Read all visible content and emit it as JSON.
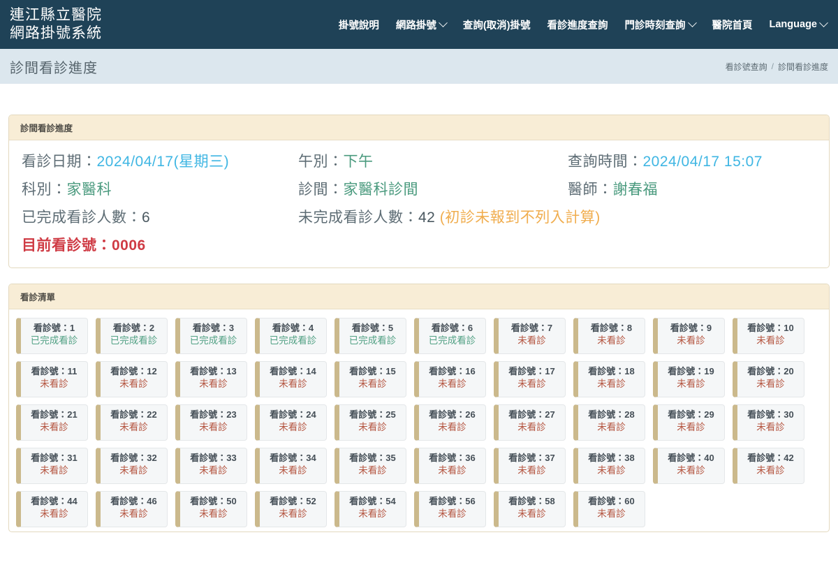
{
  "brand": {
    "line1": "連江縣立醫院",
    "line2": "網路掛號系統"
  },
  "nav": {
    "items": [
      {
        "label": "掛號說明",
        "caret": false
      },
      {
        "label": "網路掛號",
        "caret": true
      },
      {
        "label": "查詢(取消)掛號",
        "caret": false
      },
      {
        "label": "看診進度查詢",
        "caret": false
      },
      {
        "label": "門診時刻查詢",
        "caret": true
      },
      {
        "label": "醫院首頁",
        "caret": false
      },
      {
        "label": "Language",
        "caret": true
      }
    ]
  },
  "header": {
    "page_title": "診間看診進度",
    "breadcrumb_parent": "看診號查詢",
    "breadcrumb_sep": "/",
    "breadcrumb_current": "診間看診進度"
  },
  "progress_panel": {
    "title": "診間看診進度",
    "visit_date_label": "看診日期：",
    "visit_date_value": "2024/04/17(星期三)",
    "session_label": "午別：",
    "session_value": "下午",
    "query_time_label": "查詢時間：",
    "query_time_value": "2024/04/17 15:07",
    "dept_label": "科別：",
    "dept_value": "家醫科",
    "room_label": "診間：",
    "room_value": "家醫科診間",
    "doctor_label": "醫師：",
    "doctor_value": "謝春福",
    "completed_label": "已完成看診人數：",
    "completed_value": "6",
    "incomplete_label": "未完成看診人數：",
    "incomplete_value": "42",
    "incomplete_note": "(初診未報到不列入計算)",
    "current_label": "目前看診號：",
    "current_value": "0006"
  },
  "visit_list": {
    "title": "看診清單",
    "number_label": "看診號：",
    "status_done": "已完成看診",
    "status_pending": "未看診",
    "cards": [
      {
        "number": "1",
        "status": "已完成看診",
        "state": "done"
      },
      {
        "number": "2",
        "status": "已完成看診",
        "state": "done"
      },
      {
        "number": "3",
        "status": "已完成看診",
        "state": "done"
      },
      {
        "number": "4",
        "status": "已完成看診",
        "state": "done"
      },
      {
        "number": "5",
        "status": "已完成看診",
        "state": "done"
      },
      {
        "number": "6",
        "status": "已完成看診",
        "state": "done"
      },
      {
        "number": "7",
        "status": "未看診",
        "state": "pending"
      },
      {
        "number": "8",
        "status": "未看診",
        "state": "pending"
      },
      {
        "number": "9",
        "status": "未看診",
        "state": "pending"
      },
      {
        "number": "10",
        "status": "未看診",
        "state": "pending"
      },
      {
        "number": "11",
        "status": "未看診",
        "state": "pending"
      },
      {
        "number": "12",
        "status": "未看診",
        "state": "pending"
      },
      {
        "number": "13",
        "status": "未看診",
        "state": "pending"
      },
      {
        "number": "14",
        "status": "未看診",
        "state": "pending"
      },
      {
        "number": "15",
        "status": "未看診",
        "state": "pending"
      },
      {
        "number": "16",
        "status": "未看診",
        "state": "pending"
      },
      {
        "number": "17",
        "status": "未看診",
        "state": "pending"
      },
      {
        "number": "18",
        "status": "未看診",
        "state": "pending"
      },
      {
        "number": "19",
        "status": "未看診",
        "state": "pending"
      },
      {
        "number": "20",
        "status": "未看診",
        "state": "pending"
      },
      {
        "number": "21",
        "status": "未看診",
        "state": "pending"
      },
      {
        "number": "22",
        "status": "未看診",
        "state": "pending"
      },
      {
        "number": "23",
        "status": "未看診",
        "state": "pending"
      },
      {
        "number": "24",
        "status": "未看診",
        "state": "pending"
      },
      {
        "number": "25",
        "status": "未看診",
        "state": "pending"
      },
      {
        "number": "26",
        "status": "未看診",
        "state": "pending"
      },
      {
        "number": "27",
        "status": "未看診",
        "state": "pending"
      },
      {
        "number": "28",
        "status": "未看診",
        "state": "pending"
      },
      {
        "number": "29",
        "status": "未看診",
        "state": "pending"
      },
      {
        "number": "30",
        "status": "未看診",
        "state": "pending"
      },
      {
        "number": "31",
        "status": "未看診",
        "state": "pending"
      },
      {
        "number": "32",
        "status": "未看診",
        "state": "pending"
      },
      {
        "number": "33",
        "status": "未看診",
        "state": "pending"
      },
      {
        "number": "34",
        "status": "未看診",
        "state": "pending"
      },
      {
        "number": "35",
        "status": "未看診",
        "state": "pending"
      },
      {
        "number": "36",
        "status": "未看診",
        "state": "pending"
      },
      {
        "number": "37",
        "status": "未看診",
        "state": "pending"
      },
      {
        "number": "38",
        "status": "未看診",
        "state": "pending"
      },
      {
        "number": "40",
        "status": "未看診",
        "state": "pending"
      },
      {
        "number": "42",
        "status": "未看診",
        "state": "pending"
      },
      {
        "number": "44",
        "status": "未看診",
        "state": "pending"
      },
      {
        "number": "46",
        "status": "未看診",
        "state": "pending"
      },
      {
        "number": "50",
        "status": "未看診",
        "state": "pending"
      },
      {
        "number": "52",
        "status": "未看診",
        "state": "pending"
      },
      {
        "number": "54",
        "status": "未看診",
        "state": "pending"
      },
      {
        "number": "56",
        "status": "未看診",
        "state": "pending"
      },
      {
        "number": "58",
        "status": "未看診",
        "state": "pending"
      },
      {
        "number": "60",
        "status": "未看診",
        "state": "pending"
      }
    ]
  },
  "colors": {
    "navbar": "#1f4257",
    "breadcrumb_band": "#dce7ee",
    "panel_head": "#f8edd6",
    "panel_border": "#e3d9bf",
    "value_blue": "#3fb6e3",
    "value_green": "#4a9a7e",
    "value_orange": "#f0ad4e",
    "value_red": "#cf3b44",
    "card_bar": "#cbb98c",
    "status_done": "#52a184",
    "status_pending": "#b4543f"
  }
}
